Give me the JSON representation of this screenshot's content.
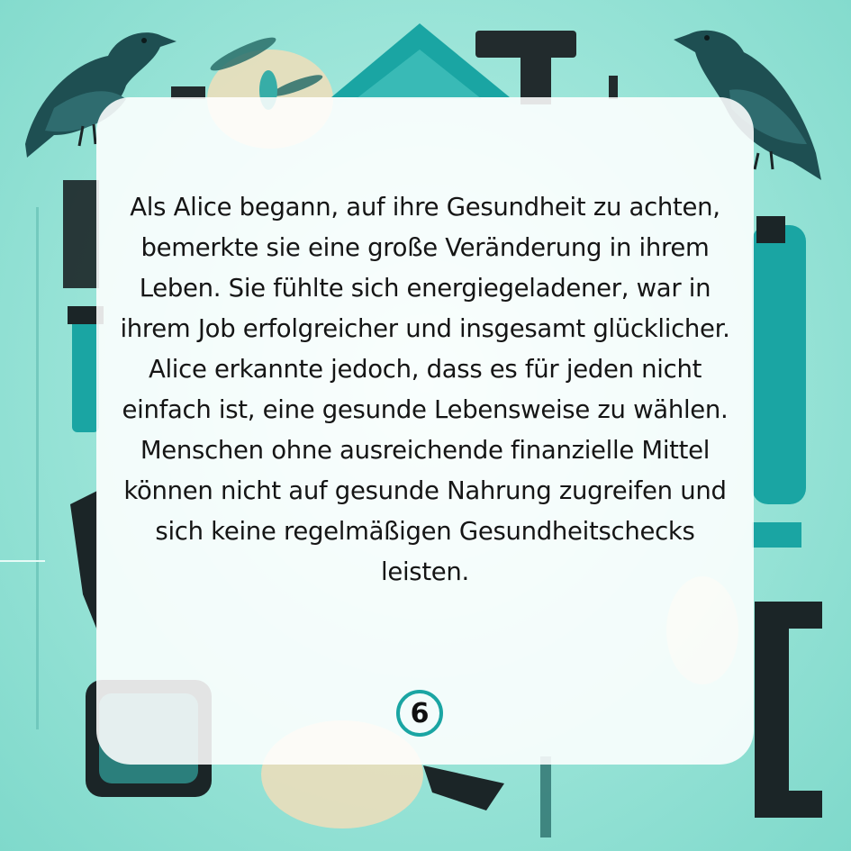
{
  "story": {
    "text": "Als Alice begann, auf ihre Gesundheit zu achten, bemerkte sie eine große Veränderung in ihrem Leben. Sie fühlte sich energiegeladener, war in ihrem Job erfolgreicher und insgesamt glücklicher. Alice erkannte jedoch, dass es für jeden nicht einfach ist, eine gesunde Lebensweise zu wählen. Menschen ohne ausreichende finanzielle Mittel können nicht auf gesunde Nahrung zugreifen und sich keine regelmäßigen Gesundheitschecks leisten."
  },
  "page": {
    "number": "6"
  },
  "colors": {
    "background": "#9fe6da",
    "teal_accent": "#1aa5a3",
    "dark_shape": "#1f2a2c",
    "bird": "#1e4f52",
    "card": "#ffffff",
    "text": "#151515"
  },
  "decorations": {
    "left_bird": "crow-illustration",
    "right_bird": "crow-illustration",
    "top_shape": "teal-envelope-shape"
  }
}
